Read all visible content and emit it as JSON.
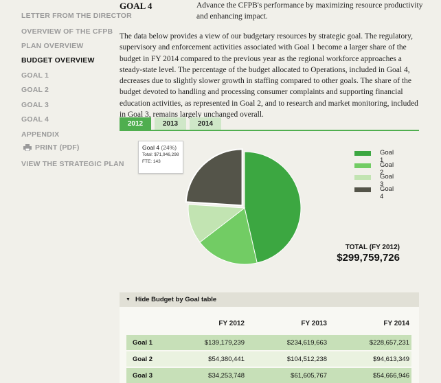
{
  "sidebar": {
    "items": [
      {
        "label": "LETTER FROM THE DIRECTOR",
        "active": false
      },
      {
        "label": "OVERVIEW OF THE CFPB",
        "active": false
      },
      {
        "label": "PLAN OVERVIEW",
        "active": false
      },
      {
        "label": "BUDGET OVERVIEW",
        "active": true
      },
      {
        "label": "GOAL 1",
        "active": false
      },
      {
        "label": "GOAL 2",
        "active": false
      },
      {
        "label": "GOAL 3",
        "active": false
      },
      {
        "label": "GOAL 4",
        "active": false
      },
      {
        "label": "APPENDIX",
        "active": false
      },
      {
        "label": "PRINT (PDF)",
        "active": false,
        "icon": "printer-icon"
      },
      {
        "label": "VIEW THE STRATEGIC PLAN",
        "active": false
      }
    ]
  },
  "goal_header": {
    "title": "GOAL 4",
    "description": "Advance the CFPB's performance by maximizing resource productivity and enhancing impact."
  },
  "intro_text": "The data below provides a view of our budgetary resources by strategic goal. The regulatory, supervisory and enforcement activities associated with Goal 1 become a larger share of the budget in FY 2014 compared to the previous year as the regional workforce approaches a steady-state level. The percentage of the budget allocated to Operations, included in Goal 4, decreases due to slightly slower growth in staffing compared to other goals. The share of the budget devoted to handling and processing consumer complaints and supporting financial education activities, as represented in Goal 2, and to research and market monitoring, included in Goal 3, remains largely unchanged overall.",
  "tabs": [
    {
      "label": "2012",
      "active": true
    },
    {
      "label": "2013",
      "active": false
    },
    {
      "label": "2014",
      "active": false
    }
  ],
  "tooltip": {
    "title": "Goal 4",
    "pct": "(24%)",
    "total": "Total: $71,946,298",
    "fte": "FTE: 143"
  },
  "total": {
    "label": "TOTAL (FY 2012)",
    "value": "$299,759,726"
  },
  "table": {
    "toggle_label": "Hide Budget by Goal table",
    "headers": [
      "FY 2012",
      "FY 2013",
      "FY 2014"
    ],
    "rows": [
      {
        "label": "Goal 1",
        "values": [
          "$139,179,239",
          "$234,619,663",
          "$228,657,231"
        ]
      },
      {
        "label": "Goal 2",
        "values": [
          "$54,380,441",
          "$104,512,238",
          "$94,613,349"
        ]
      },
      {
        "label": "Goal 3",
        "values": [
          "$34,253,748",
          "$61,605,767",
          "$54,666,946"
        ]
      }
    ]
  },
  "colors": {
    "accent": "#4fae4f",
    "goal1": "#3ca741",
    "goal2": "#72cc64",
    "goal3": "#c2e4b2",
    "goal4": "#545449"
  },
  "chart_data": {
    "type": "pie",
    "series": [
      {
        "name": "Goal 1",
        "value": 139179239
      },
      {
        "name": "Goal 2",
        "value": 54380441
      },
      {
        "name": "Goal 3",
        "value": 34253748
      },
      {
        "name": "Goal 4",
        "value": 71946298
      }
    ],
    "highlighted": "Goal 4",
    "legend_position": "right"
  }
}
